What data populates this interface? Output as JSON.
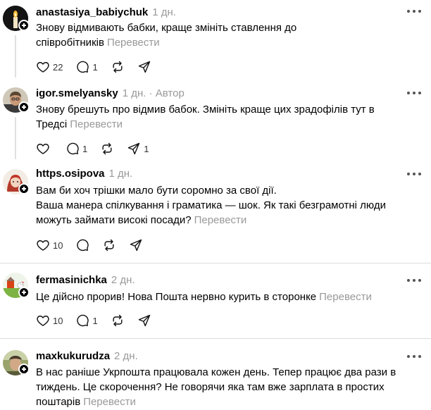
{
  "posts": [
    {
      "username": "anastasiya_babiychuk",
      "time": "1 дн.",
      "author": "",
      "text": "Знову відмивають бабки, краще змініть ставлення до співробітників",
      "translate": "Перевести",
      "likes": "22",
      "replies": "1",
      "shares": ""
    },
    {
      "username": "igor.smelyansky",
      "time": "1 дн.",
      "author": "· Автор",
      "text": "Знову брешуть про відмив бабок. Змініть краще цих зрадофілів тут в Тредсі",
      "translate": "Перевести",
      "likes": "",
      "replies": "1",
      "shares": "1"
    },
    {
      "username": "https.osipova",
      "time": "1 дн.",
      "author": "",
      "text_line1": "Вам би хоч трішки мало бути соромно за свої дії.",
      "text_line2": "Ваша манера спілкування і граматика — шок. Як такі безграмотні люди можуть займати високі посади?",
      "translate": "Перевести",
      "likes": "10",
      "replies": "",
      "shares": ""
    },
    {
      "username": "fermasinichka",
      "time": "2 дн.",
      "author": "",
      "text": "Це дійсно прорив! Нова Пошта нервно курить в сторонке",
      "translate": "Перевести",
      "likes": "10",
      "replies": "1",
      "shares": ""
    },
    {
      "username": "maxkukurudza",
      "time": "2 дн.",
      "author": "",
      "text": "В нас раніше Укрпошта працювала кожен день. Тепер працює два рази в тиждень. Це скорочення? Не говорячи яка там вже зарплата в простих поштарів",
      "translate": "Перевести"
    }
  ],
  "icons": {
    "like": "heart-icon",
    "reply": "comment-icon",
    "repost": "repost-icon",
    "share": "send-icon",
    "more": "more-dots-icon",
    "follow": "plus-icon"
  }
}
